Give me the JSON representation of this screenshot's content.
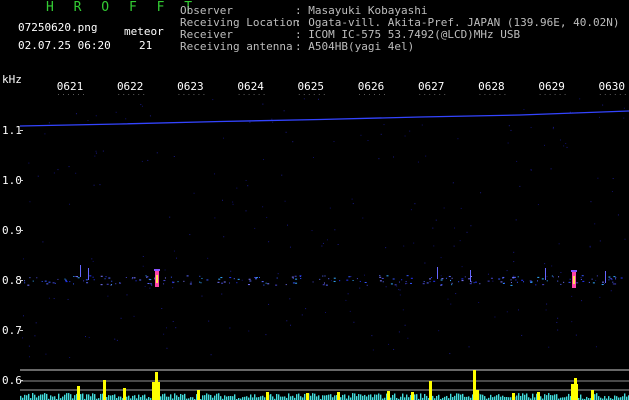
{
  "app": {
    "title": "H R O F F T"
  },
  "file": {
    "name": "07250620.png",
    "datetime": "02.07.25 06:20"
  },
  "meteor": {
    "label": "meteor",
    "count": "21"
  },
  "info": [
    {
      "key": "Observer",
      "value": ": Masayuki Kobayashi"
    },
    {
      "key": "Receiving Location",
      "value": ": Ogata-vill. Akita-Pref. JAPAN (139.96E, 40.02N)"
    },
    {
      "key": "Receiver",
      "value": ": ICOM IC-575 53.7492(@LCD)MHz USB"
    },
    {
      "key": "Receiving antenna",
      "value": ": A504HB(yagi 4el)"
    }
  ],
  "axis": {
    "unit": "kHz",
    "freq_labels": [
      "1.1",
      "1.0",
      "0.9",
      "0.8",
      "0.7",
      "0.6"
    ],
    "time_labels": [
      "0621",
      "0622",
      "0623",
      "0624",
      "0625",
      "0626",
      "0627",
      "0628",
      "0629",
      "0630"
    ]
  },
  "colors": {
    "background": "#000000",
    "title_green": "#33cc33",
    "carrier_blue": "#3344ff",
    "echo_yellow": "#ffff00",
    "noise_cyan": "#44dddd"
  }
}
